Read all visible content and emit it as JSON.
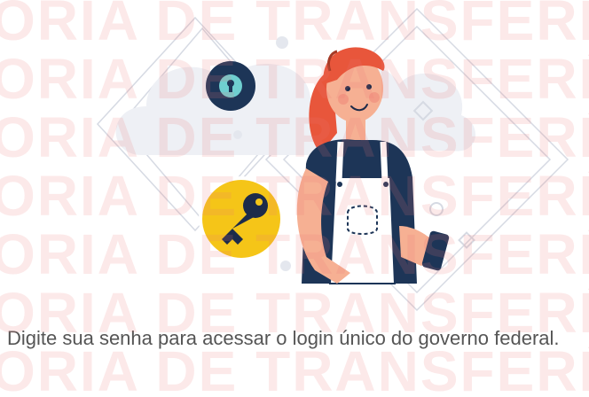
{
  "watermark": {
    "lines": [
      "ORIA DE TRANSFERÊNC",
      "ORIA DE TRANSFERÊNC",
      "ORIA DE TRANSFERÊNC",
      "ORIA DE TRANSFERÊNC",
      "ORIA DE TRANSFERÊNC",
      "ORIA DE TRANSFERÊNC",
      "ORIA DE TRANSFERÊNC"
    ]
  },
  "illustration": {
    "badges": [
      "keyhole-icon",
      "key-icon"
    ],
    "colors": {
      "key_badge": "#f5c518",
      "keyhole_badge": "#1d3557",
      "hair": "#e8563b",
      "shirt": "#1d3557",
      "skin": "#f6b093",
      "apron": "#ffffff",
      "cloud": "#eef0f5"
    }
  },
  "instruction": {
    "text": "Digite sua senha para acessar o login único do governo federal."
  }
}
